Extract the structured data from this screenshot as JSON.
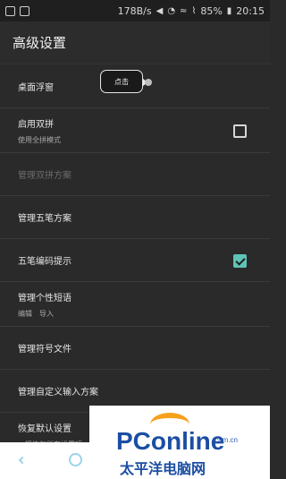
{
  "status_bar": {
    "speed": "178B/s",
    "battery": "85%",
    "time": "20:15",
    "icons": [
      "notification-icon",
      "image-icon",
      "mute-icon",
      "alarm-icon",
      "wifi-icon",
      "signal-icon",
      "battery-icon"
    ]
  },
  "app_bar": {
    "title": "高级设置"
  },
  "tooltip": {
    "label": "点击"
  },
  "rows": [
    {
      "title": "桌面浮窗",
      "subtitle": ""
    },
    {
      "title": "启用双拼",
      "subtitle": "使用全拼模式",
      "checked": false
    },
    {
      "title": "管理双拼方案",
      "disabled": true
    },
    {
      "title": "管理五笔方案"
    },
    {
      "title": "五笔编码提示",
      "checked": true
    },
    {
      "title": "管理个性短语",
      "subtitle": "编辑　导入"
    },
    {
      "title": "管理符号文件"
    },
    {
      "title": "管理自定义输入方案"
    },
    {
      "title": "恢复默认设置",
      "subtitle": "一键恢复所有设置项"
    }
  ],
  "watermark": {
    "logo": "PConline",
    "domain": ".com.cn",
    "subtitle": "太平洋电脑网"
  },
  "colors": {
    "accent": "#5fc4b6",
    "background": "#2a2a2a"
  }
}
